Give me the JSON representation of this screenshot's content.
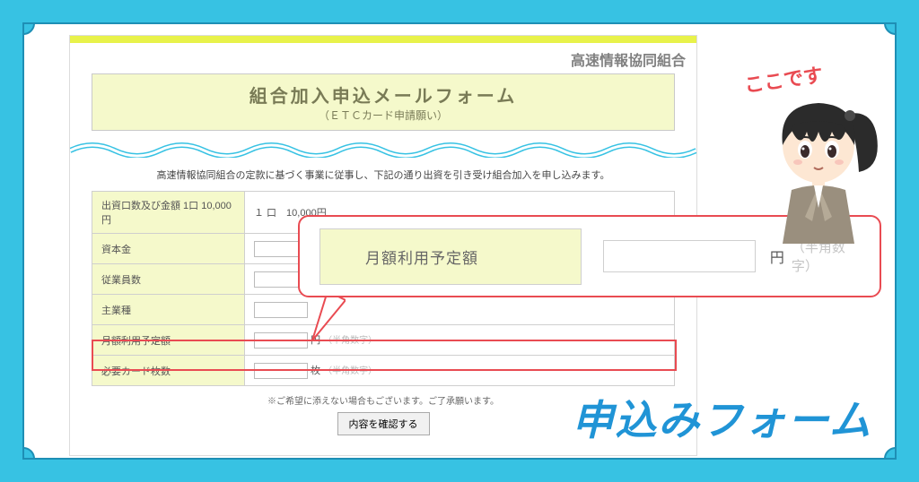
{
  "page": {
    "org_title": "高速情報協同組合",
    "main_title": "組合加入申込メールフォーム",
    "sub_title": "（ＥＴＣカード申請願い）",
    "intro": "高速情報協同組合の定款に基づく事業に従事し、下記の通り出資を引き受け組合加入を申し込みます。"
  },
  "rows": {
    "r1_label": "出資口数及び金額 1口 10,000円",
    "r1_value": "１ 口　10,000円",
    "r2_label": "資本金",
    "r3_label": "従業員数",
    "r4_label": "主業種",
    "r5_label": "月額利用予定額",
    "r5_unit": "円",
    "r5_hint": "（半角数字）",
    "r6_label": "必要カード枚数",
    "r6_unit": "枚",
    "r6_hint": "（半角数字）"
  },
  "form_note": "※ご希望に添えない場合もございます。ご了承願います。",
  "confirm_button": "内容を確認する",
  "callout": {
    "label": "月額利用予定額",
    "unit": "円",
    "hint": "（半角数字）"
  },
  "annotation": "ここです",
  "big_cta": "申込みフォーム"
}
